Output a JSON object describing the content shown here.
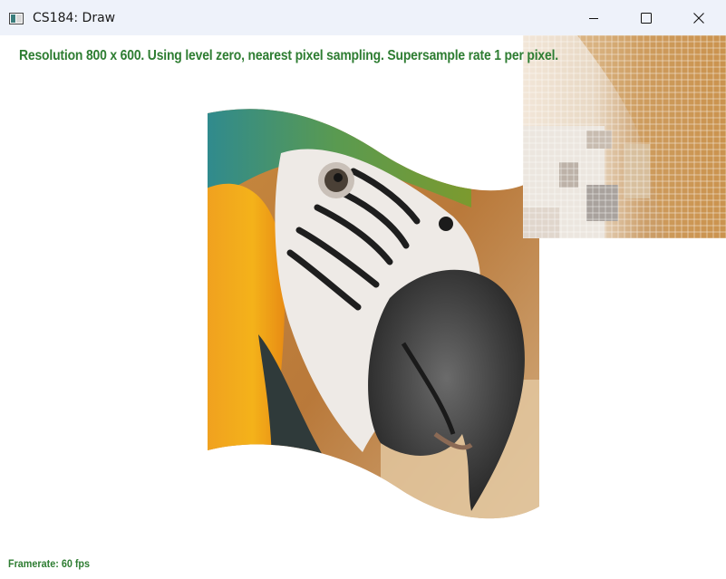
{
  "window": {
    "title": "CS184: Draw",
    "icon": "app-window-icon",
    "controls": {
      "minimize_icon": "minimize-icon",
      "maximize_icon": "maximize-icon",
      "close_icon": "close-icon"
    }
  },
  "canvas": {
    "status_text": "Resolution 800 x 600. Using level zero, nearest pixel sampling. Supersample rate 1 per pixel.",
    "framerate_text": "Framerate: 60 fps",
    "text_color": "#2e7d32",
    "background": "#ffffff"
  },
  "zoom_inset": {
    "grid_color": "#ffffff"
  }
}
